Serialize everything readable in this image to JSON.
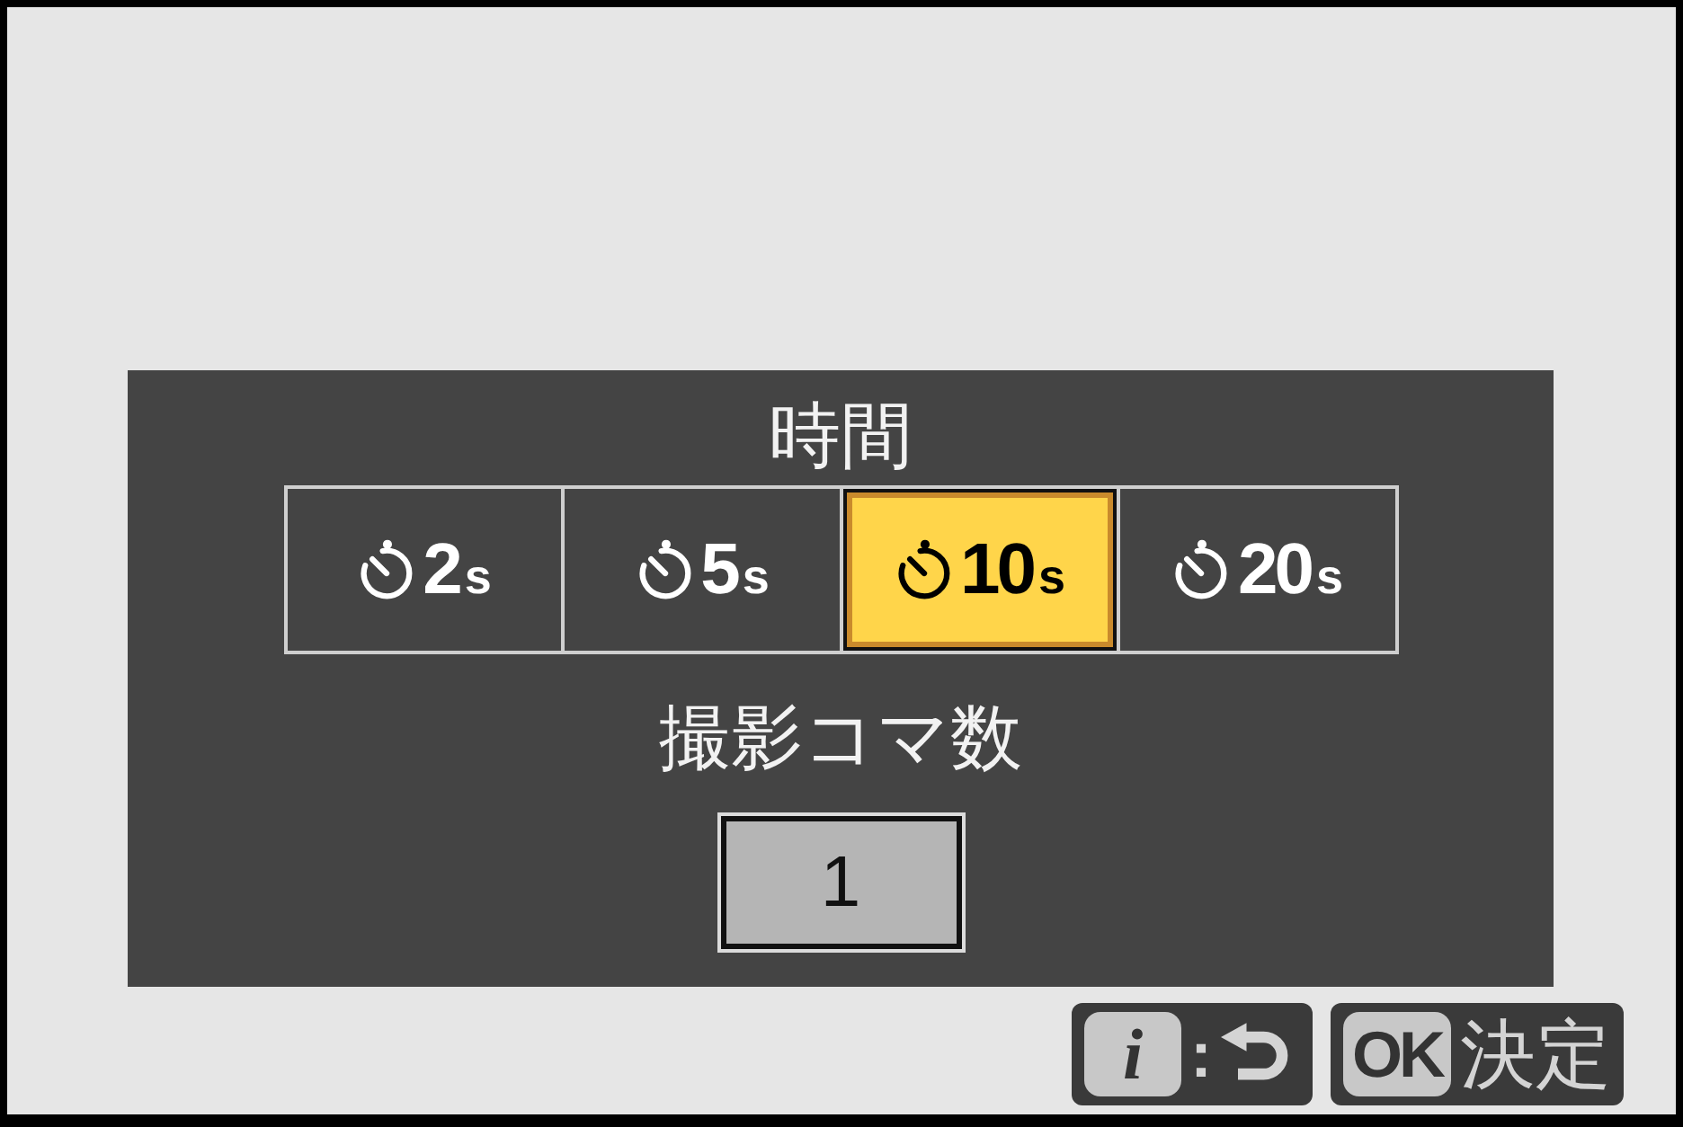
{
  "dialog": {
    "timer": {
      "title": "時間",
      "options": [
        {
          "value": "2",
          "unit": "s",
          "selected": false
        },
        {
          "value": "5",
          "unit": "s",
          "selected": false
        },
        {
          "value": "10",
          "unit": "s",
          "selected": true
        },
        {
          "value": "20",
          "unit": "s",
          "selected": false
        }
      ]
    },
    "shots": {
      "title": "撮影コマ数",
      "value": "1"
    }
  },
  "hints": [
    {
      "kind": "back",
      "key": "i",
      "separator": ":"
    },
    {
      "kind": "confirm",
      "key": "OK",
      "label": "決定"
    }
  ]
}
